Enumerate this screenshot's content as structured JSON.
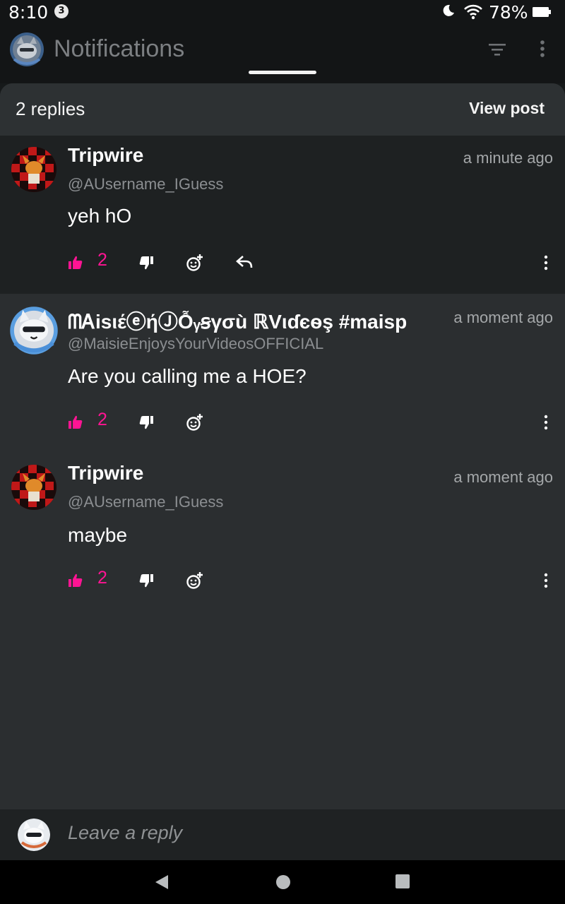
{
  "status_bar": {
    "time": "8:10",
    "notification_count": "3",
    "battery": "78%"
  },
  "header": {
    "title": "Notifications"
  },
  "sheet": {
    "replies_label": "2 replies",
    "view_post_label": "View post"
  },
  "comments": [
    {
      "author": "Tripwire",
      "handle": "@AUsername_IGuess",
      "time": "a minute ago",
      "text": "yeh hO",
      "likes": "2",
      "has_reply": true
    },
    {
      "author": "ᗰᎪiѕιέⓔήⒿỖᵧꞩγσù ℝVιɗєѳş #maisp",
      "handle": "@MaisieEnjoysYourVideosOFFICIAL",
      "time": "a moment ago",
      "text": "Are you calling me a HOE?",
      "likes": "2",
      "has_reply": false
    },
    {
      "author": "Tripwire",
      "handle": "@AUsername_IGuess",
      "time": "a moment ago",
      "text": "maybe",
      "likes": "2",
      "has_reply": false
    }
  ],
  "compose": {
    "placeholder": "Leave a reply"
  },
  "colors": {
    "accent_like": "#ff1493",
    "sheet_bg": "#2b2e30",
    "highlight_bg": "#1e2122"
  }
}
